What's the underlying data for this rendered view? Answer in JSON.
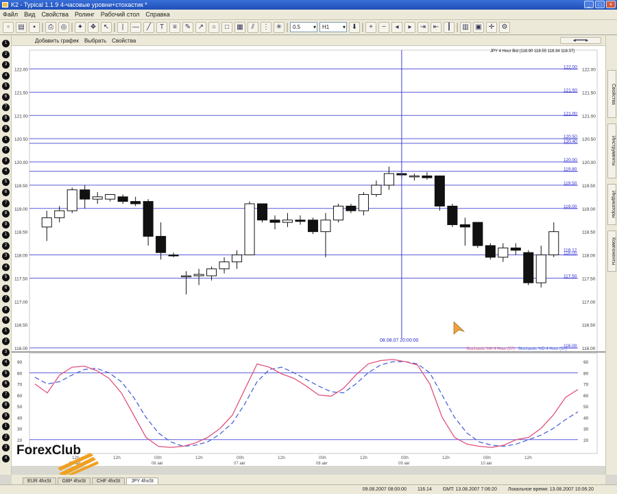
{
  "window": {
    "title": "K2 - Typical 1.1.9 4-часовые уровни+стохастик *"
  },
  "menu": [
    "Файл",
    "Вид",
    "Свойства",
    "Ролинг",
    "Рабочий стол",
    "Справка"
  ],
  "toolbar": {
    "interval_select": "0.5",
    "timeframe_select": "H1"
  },
  "chart_toolbar": {
    "add_chart": "Добавить графек",
    "select": "Выбрать",
    "properties": "Свойства"
  },
  "instrument_info": "JPY 4 Hour Bid (118.90 118.55 118.34 118.37)",
  "crosshair_time": "08.08.07 20:00:00",
  "price_axis": {
    "ticks": [
      "122.00",
      "121.50",
      "121.00",
      "120.50",
      "120.00",
      "119.50",
      "119.00",
      "118.50",
      "118.00",
      "117.50",
      "117.00",
      "116.50",
      "116.00"
    ],
    "level_labels": [
      "122.00",
      "121.50",
      "121.00",
      "120.50",
      "120.40",
      "120.00",
      "119.80",
      "119.50",
      "119.00",
      "118.00",
      "117.50",
      "116.00"
    ],
    "current_price": "118.12"
  },
  "stoch_legend": {
    "main": "Stochastic %K 4 Hour (57)",
    "signal": "Stochastic %D 4 Hour (57)"
  },
  "stoch_axis": [
    "90",
    "80",
    "70",
    "60",
    "50",
    "40",
    "30",
    "20"
  ],
  "time_axis": [
    {
      "main": "12h",
      "sub": "03 авг"
    },
    {
      "main": "12h",
      "sub": ""
    },
    {
      "main": "00h",
      "sub": "06 авг"
    },
    {
      "main": "12h",
      "sub": ""
    },
    {
      "main": "00h",
      "sub": "07 авг"
    },
    {
      "main": "12h",
      "sub": ""
    },
    {
      "main": "00h",
      "sub": "08 авг"
    },
    {
      "main": "12h",
      "sub": ""
    },
    {
      "main": "00h",
      "sub": "09 авг"
    },
    {
      "main": "12h",
      "sub": ""
    },
    {
      "main": "00h",
      "sub": "10 авг"
    },
    {
      "main": "12h",
      "sub": ""
    }
  ],
  "chart_data": {
    "type": "candlestick",
    "ylim": [
      116.0,
      122.2
    ],
    "levels": [
      122.0,
      121.5,
      121.0,
      120.5,
      120.4,
      120.0,
      119.8,
      119.5,
      119.0,
      118.0,
      117.5,
      116.0
    ],
    "candles": [
      {
        "o": 118.6,
        "h": 118.95,
        "l": 118.3,
        "c": 118.8
      },
      {
        "o": 118.8,
        "h": 119.05,
        "l": 118.7,
        "c": 118.95
      },
      {
        "o": 118.95,
        "h": 119.45,
        "l": 118.9,
        "c": 119.4
      },
      {
        "o": 119.4,
        "h": 119.5,
        "l": 119.0,
        "c": 119.2
      },
      {
        "o": 119.2,
        "h": 119.35,
        "l": 119.1,
        "c": 119.25
      },
      {
        "o": 119.2,
        "h": 119.3,
        "l": 119.15,
        "c": 119.3
      },
      {
        "o": 119.25,
        "h": 119.3,
        "l": 119.1,
        "c": 119.15
      },
      {
        "o": 119.15,
        "h": 119.25,
        "l": 119.05,
        "c": 119.1
      },
      {
        "o": 119.15,
        "h": 119.2,
        "l": 118.2,
        "c": 118.4
      },
      {
        "o": 118.4,
        "h": 118.7,
        "l": 117.9,
        "c": 118.05
      },
      {
        "o": 118.0,
        "h": 118.05,
        "l": 117.95,
        "c": 117.98
      },
      {
        "o": 117.55,
        "h": 117.65,
        "l": 117.15,
        "c": 117.55
      },
      {
        "o": 117.55,
        "h": 117.7,
        "l": 117.35,
        "c": 117.58
      },
      {
        "o": 117.55,
        "h": 117.75,
        "l": 117.45,
        "c": 117.7
      },
      {
        "o": 117.7,
        "h": 117.95,
        "l": 117.6,
        "c": 117.85
      },
      {
        "o": 117.85,
        "h": 118.1,
        "l": 117.7,
        "c": 118.0
      },
      {
        "o": 118.0,
        "h": 119.15,
        "l": 118.0,
        "c": 119.1
      },
      {
        "o": 119.1,
        "h": 119.1,
        "l": 118.7,
        "c": 118.75
      },
      {
        "o": 118.75,
        "h": 118.85,
        "l": 118.55,
        "c": 118.7
      },
      {
        "o": 118.7,
        "h": 118.9,
        "l": 118.6,
        "c": 118.75
      },
      {
        "o": 118.75,
        "h": 118.85,
        "l": 118.65,
        "c": 118.72
      },
      {
        "o": 118.75,
        "h": 118.8,
        "l": 118.45,
        "c": 118.5
      },
      {
        "o": 118.5,
        "h": 118.9,
        "l": 117.95,
        "c": 118.75
      },
      {
        "o": 118.75,
        "h": 119.1,
        "l": 118.7,
        "c": 119.05
      },
      {
        "o": 119.05,
        "h": 119.1,
        "l": 118.9,
        "c": 118.95
      },
      {
        "o": 118.95,
        "h": 119.35,
        "l": 118.85,
        "c": 119.3
      },
      {
        "o": 119.3,
        "h": 119.6,
        "l": 119.25,
        "c": 119.5
      },
      {
        "o": 119.5,
        "h": 119.9,
        "l": 119.4,
        "c": 119.75
      },
      {
        "o": 119.75,
        "h": 119.8,
        "l": 119.65,
        "c": 119.72
      },
      {
        "o": 119.7,
        "h": 119.75,
        "l": 119.6,
        "c": 119.7
      },
      {
        "o": 119.7,
        "h": 119.78,
        "l": 119.62,
        "c": 119.66
      },
      {
        "o": 119.7,
        "h": 119.7,
        "l": 118.95,
        "c": 119.05
      },
      {
        "o": 119.05,
        "h": 119.1,
        "l": 118.6,
        "c": 118.65
      },
      {
        "o": 118.65,
        "h": 118.8,
        "l": 118.2,
        "c": 118.6
      },
      {
        "o": 118.7,
        "h": 118.7,
        "l": 118.15,
        "c": 118.2
      },
      {
        "o": 118.2,
        "h": 118.25,
        "l": 117.9,
        "c": 117.95
      },
      {
        "o": 117.95,
        "h": 118.25,
        "l": 117.85,
        "c": 118.15
      },
      {
        "o": 118.15,
        "h": 118.25,
        "l": 118.0,
        "c": 118.1
      },
      {
        "o": 118.05,
        "h": 118.1,
        "l": 117.35,
        "c": 117.4
      },
      {
        "o": 117.4,
        "h": 118.2,
        "l": 117.3,
        "c": 118.0
      },
      {
        "o": 118.0,
        "h": 118.7,
        "l": 117.95,
        "c": 118.5
      }
    ],
    "stochastic": {
      "ylim": [
        10,
        95
      ],
      "k": [
        70,
        62,
        78,
        85,
        86,
        82,
        75,
        62,
        42,
        22,
        14,
        13,
        14,
        17,
        22,
        30,
        42,
        65,
        88,
        85,
        79,
        75,
        68,
        60,
        59,
        66,
        78,
        88,
        91,
        92,
        90,
        87,
        70,
        40,
        22,
        16,
        14,
        13,
        15,
        20,
        22,
        30,
        42,
        58,
        65
      ],
      "d": [
        76,
        70,
        72,
        78,
        83,
        84,
        80,
        72,
        58,
        40,
        26,
        18,
        14,
        15,
        18,
        25,
        35,
        52,
        72,
        83,
        85,
        80,
        74,
        68,
        63,
        62,
        70,
        80,
        87,
        90,
        90,
        88,
        80,
        60,
        40,
        26,
        18,
        15,
        14,
        16,
        20,
        24,
        30,
        38,
        45
      ]
    }
  }
}
